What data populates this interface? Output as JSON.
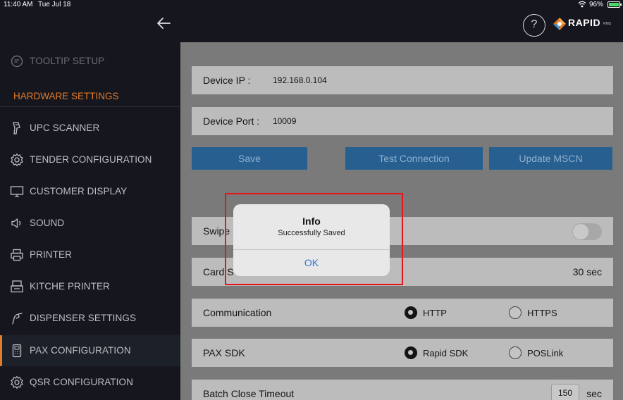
{
  "status_bar": {
    "time": "11:40 AM",
    "date": "Tue Jul 18",
    "battery": "96%"
  },
  "header": {
    "help_label": "?",
    "logo_text": "RAPID",
    "logo_sub": "RMS"
  },
  "sidebar": {
    "tooltip_setup": "TOOLTIP SETUP",
    "section_title": "HARDWARE SETTINGS",
    "items": [
      {
        "label": "UPC SCANNER",
        "icon": "scanner-icon"
      },
      {
        "label": "TENDER CONFIGURATION",
        "icon": "gear-icon"
      },
      {
        "label": "CUSTOMER DISPLAY",
        "icon": "monitor-icon"
      },
      {
        "label": "SOUND",
        "icon": "speaker-icon"
      },
      {
        "label": "PRINTER",
        "icon": "printer-icon"
      },
      {
        "label": "KITCHE PRINTER",
        "icon": "kitchen-printer-icon"
      },
      {
        "label": "DISPENSER SETTINGS",
        "icon": "dispenser-icon"
      },
      {
        "label": "PAX CONFIGURATION",
        "icon": "card-terminal-icon",
        "active": true
      },
      {
        "label": "QSR CONFIGURATION",
        "icon": "gear-icon"
      }
    ],
    "accent_color": "#e07b2a"
  },
  "main": {
    "device_ip_label": "Device IP :",
    "device_ip_value": "192.168.0.104",
    "device_port_label": "Device Port :",
    "device_port_value": "10009",
    "save_label": "Save",
    "test_connection_label": "Test Connection",
    "update_mscn_label": "Update MSCN",
    "swipe_label": "Swipe",
    "card_label": "Card S",
    "card_value": "30 sec",
    "communication_label": "Communication",
    "comm_http": "HTTP",
    "comm_https": "HTTPS",
    "comm_selected": "HTTP",
    "pax_sdk_label": "PAX SDK",
    "sdk_rapid": "Rapid SDK",
    "sdk_poslink": "POSLink",
    "sdk_selected": "Rapid SDK",
    "batch_close_label": "Batch Close Timeout",
    "batch_close_value": "150",
    "batch_close_unit": "sec",
    "button_color": "#275f90"
  },
  "dialog": {
    "title": "Info",
    "message": "Successfully Saved",
    "ok_label": "OK",
    "ok_color": "#2b7ad6"
  }
}
